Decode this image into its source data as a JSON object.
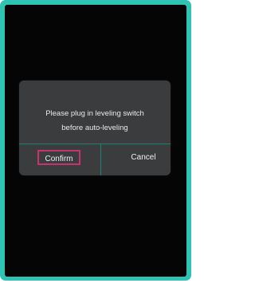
{
  "dialog": {
    "message_line1": "Please plug in leveling switch",
    "message_line2": "before auto-leveling",
    "confirm_label": "Confirm",
    "cancel_label": "Cancel"
  },
  "colors": {
    "device_frame": "#2ec3b3",
    "screen_background": "#050505",
    "dialog_background": "#3a3c3e",
    "divider": "#1f7f79",
    "selection_highlight": "#c8336f"
  }
}
